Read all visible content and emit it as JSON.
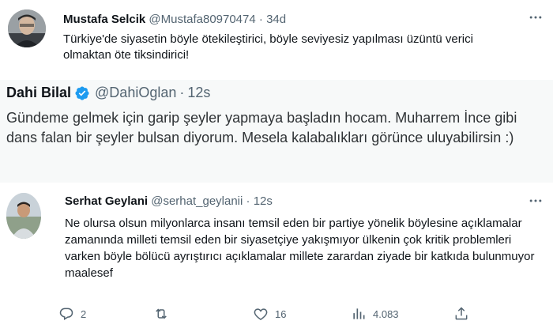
{
  "tweet1": {
    "name": "Mustafa Selcik",
    "handle": "@Mustafa80970474",
    "separator": "·",
    "time": "34d",
    "text": "Türkiye'de siyasetin böyle ötekileştirici, böyle seviyesiz yapılması üzüntü verici olmaktan öte tiksindirici!"
  },
  "quote": {
    "name": "Dahi Bilal",
    "handle": "@DahiOglan",
    "separator": "·",
    "time": "12s",
    "text": "Gündeme gelmek için garip şeyler yapmaya başladın hocam. Muharrem İnce gibi dans falan bir şeyler bulsan diyorum. Mesela kalabalıkları görünce uluyabilirsin :)"
  },
  "tweet2": {
    "name": "Serhat Geylani",
    "handle": "@serhat_geylanii",
    "separator": "·",
    "time": "12s",
    "text": "Ne olursa olsun milyonlarca insanı temsil eden bir partiye yönelik böylesine açıklamalar zamanında milleti temsil eden bir siyasetçiye yakışmıyor ülkenin çok kritik problemleri varken böyle bölücü ayrıştırıcı açıklamalar millete zarardan ziyade bir katkıda bulunmuyor maalesef",
    "actions": {
      "replies": "2",
      "retweets": "",
      "likes": "16",
      "views": "4.083"
    }
  },
  "colors": {
    "text": "#0f1419",
    "secondary": "#536471",
    "verified": "#1d9bf0",
    "quote_bg": "#f7f9f9"
  },
  "icons": [
    "more-icon",
    "verified-badge-icon",
    "reply-icon",
    "retweet-icon",
    "like-icon",
    "views-icon",
    "share-icon"
  ]
}
